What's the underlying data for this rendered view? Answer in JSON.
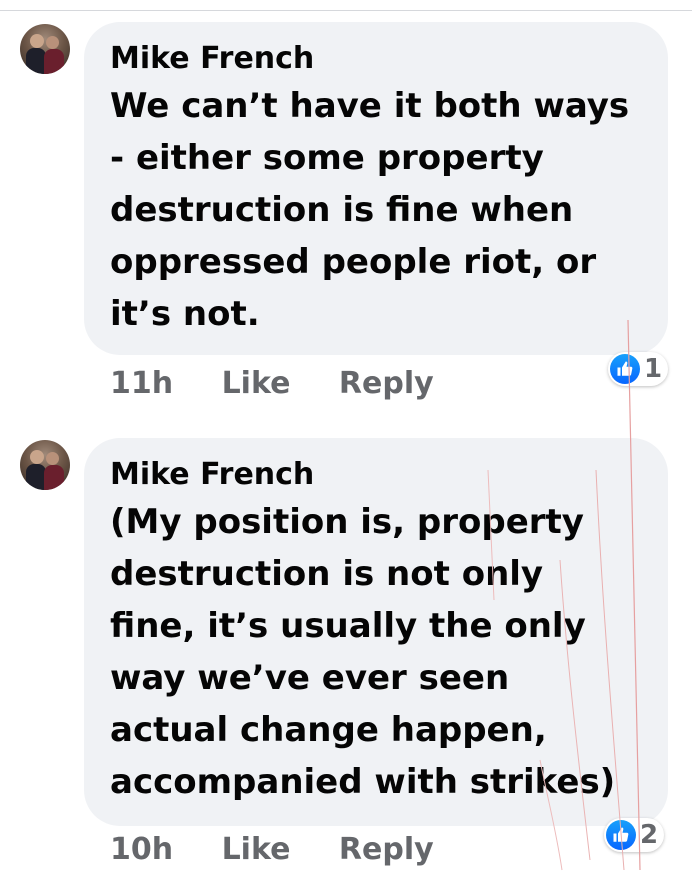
{
  "comments": [
    {
      "author": "Mike French",
      "text": "We can’t have it both ways\n- either some property\ndestruction is fine when\noppressed people riot, or\nit’s not.",
      "time": "11h",
      "like_label": "Like",
      "reply_label": "Reply",
      "reactions": "1"
    },
    {
      "author": "Mike French",
      "text": "(My position is, property\ndestruction is not only\nfine, it’s usually the only\nway we’ve ever seen\nactual change happen,\naccompanied with strikes)",
      "time": "10h",
      "like_label": "Like",
      "reply_label": "Reply",
      "reactions": "2"
    }
  ],
  "icons": {
    "reaction": "like-thumb-icon",
    "avatar": "profile-photo"
  },
  "colors": {
    "bubble": "#f0f2f5",
    "like_blue": "#0866ff",
    "meta_gray": "#65676b"
  }
}
